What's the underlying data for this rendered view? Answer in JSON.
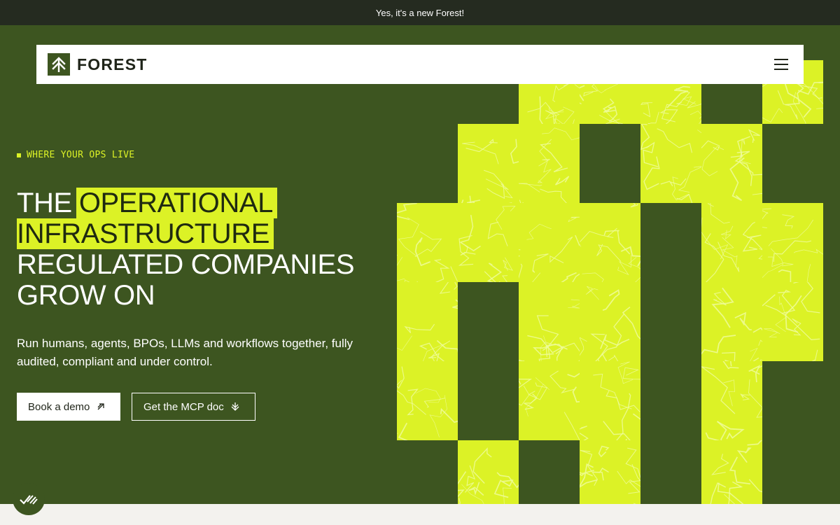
{
  "announcement": {
    "text": "Yes, it's a new Forest!"
  },
  "navbar": {
    "brand": "FOREST",
    "menu_icon": "hamburger-menu-icon",
    "logo_icon": "forest-arrow-logo-icon"
  },
  "hero": {
    "eyebrow": "WHERE YOUR OPS LIVE",
    "headline": {
      "line1_plain": "THE",
      "line1_highlight": "OPERATIONAL",
      "line2_highlight": "INFRASTRUCTURE",
      "line3": "REGULATED COMPANIES",
      "line4": "GROW ON"
    },
    "subtext": "Run humans, agents, BPOs, LLMs and workflows together, fully audited, compliant and under control.",
    "buttons": {
      "primary_label": "Book a demo",
      "primary_icon": "arrow-up-right-icon",
      "secondary_label": "Get the MCP doc",
      "secondary_icon": "arrow-down-icon"
    }
  },
  "cookie_badge": {
    "icon": "check-marks-icon"
  },
  "colors": {
    "forest_green": "#3d5520",
    "lime": "#dcf226",
    "dark": "#252b20",
    "white": "#ffffff"
  }
}
